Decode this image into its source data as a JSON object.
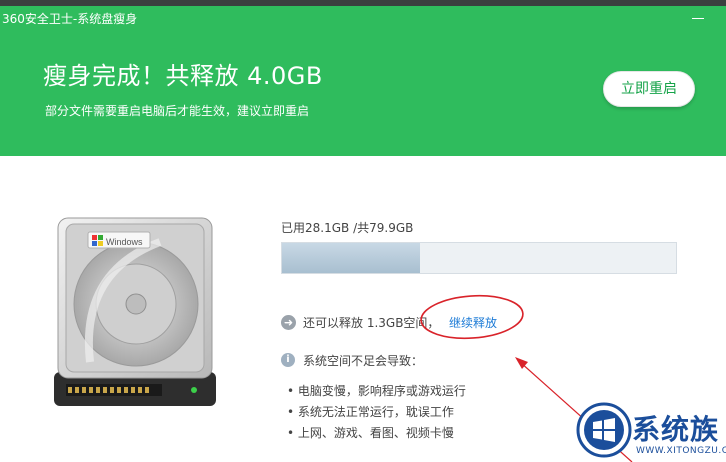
{
  "window": {
    "title": "360安全卫士-系统盘瘦身"
  },
  "header": {
    "headline": "瘦身完成！共释放 4.0GB",
    "subline": "部分文件需要重启电脑后才能生效，建议立即重启",
    "restart_label": "立即重启"
  },
  "disk": {
    "brand": "Windows",
    "used_label": "已用28.1GB /共79.9GB",
    "used_fraction": 0.35
  },
  "release": {
    "text": "还可以释放 1.3GB空间，",
    "link": "继续释放"
  },
  "warning": {
    "title": "系统空间不足会导致：",
    "items": [
      "• 电脑变慢，影响程序或游戏运行",
      "• 系统无法正常运行，耽误工作",
      "• 上网、游戏、看图、视频卡慢"
    ]
  },
  "watermark": {
    "text": "系统族",
    "sub": "WWW.XITONGZU.COM"
  },
  "colors": {
    "header_green": "#2fbc5d",
    "link_blue": "#1d7bd6",
    "annotation_red": "#d9232a"
  }
}
